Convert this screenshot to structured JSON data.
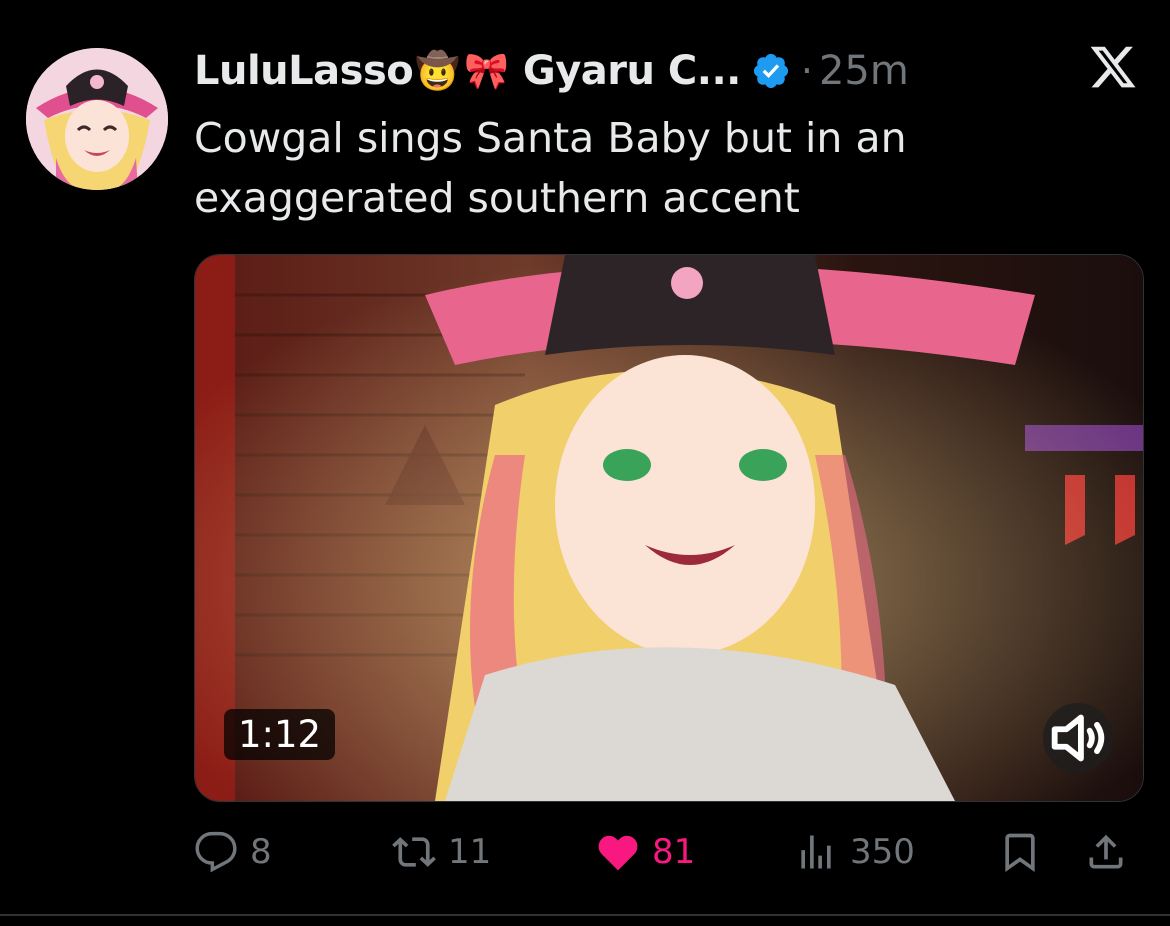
{
  "tweet": {
    "display_name": "LuluLasso",
    "emoji_1": "🤠",
    "emoji_2": "🎀",
    "name_suffix": "Gyaru C...",
    "separator": "·",
    "time": "25m",
    "text_line_1": "Cowgal sings Santa Baby but in an",
    "text_line_2": "exaggerated southern accent"
  },
  "media": {
    "duration": "1:12"
  },
  "actions": {
    "replies": "8",
    "reposts": "11",
    "likes": "81",
    "views": "350"
  },
  "colors": {
    "background": "#000000",
    "text": "#e7e9ea",
    "muted": "#71767b",
    "like": "#f91880",
    "verified": "#1d9bf0"
  },
  "icons": [
    "x-logo-icon",
    "verified-icon",
    "reply-icon",
    "repost-icon",
    "like-icon",
    "views-icon",
    "bookmark-icon",
    "share-icon",
    "volume-icon"
  ]
}
